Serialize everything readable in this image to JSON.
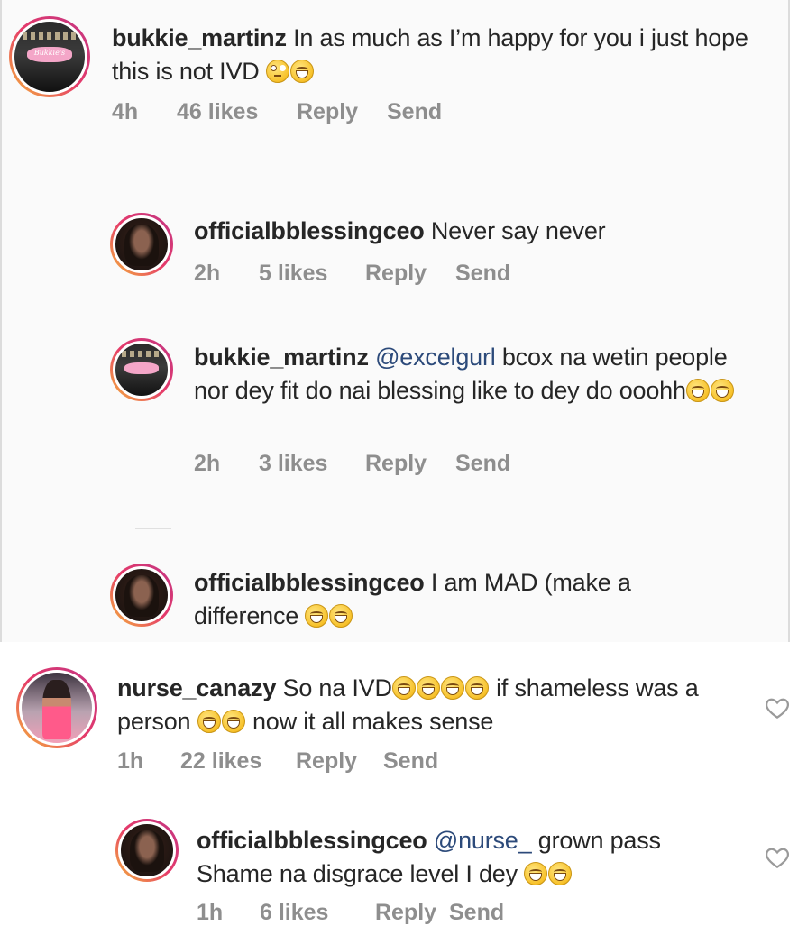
{
  "comments": [
    {
      "username": "bukkie_martinz",
      "avatar": "bukkie-avatar",
      "text_before": " In as much as I’m happy for you i just hope this is not IVD ",
      "emojis": [
        "eye-roll-emoji",
        "laughing-emoji"
      ],
      "time": "4h",
      "likes": "46 likes",
      "reply": "Reply",
      "send": "Send"
    },
    {
      "username": "officialbblessingceo",
      "avatar": "blessing-avatar",
      "text_before": " Never say never",
      "time": "2h",
      "likes": "5 likes",
      "reply": "Reply",
      "send": "Send"
    },
    {
      "username": "bukkie_martinz",
      "avatar": "bukkie-avatar",
      "mention": "@excelgurl",
      "text_before": " bcox na wetin people nor dey fit do nai blessing like to dey do ooohh",
      "emojis": [
        "laughing-emoji",
        "laughing-emoji"
      ],
      "time": "2h",
      "likes": "3 likes",
      "reply": "Reply",
      "send": "Send"
    },
    {
      "username": "officialbblessingceo",
      "avatar": "blessing-avatar",
      "text_before": " I am MAD (make a difference ",
      "emojis": [
        "laughing-emoji",
        "laughing-emoji"
      ]
    },
    {
      "username": "nurse_canazy",
      "avatar": "nurse-avatar",
      "text_before": " So na IVD",
      "text_middle": " if shameless was a person ",
      "text_after": " now it all makes sense",
      "time": "1h",
      "likes": "22 likes",
      "reply": "Reply",
      "send": "Send"
    },
    {
      "username": "officialbblessingceo",
      "avatar": "blessing-avatar",
      "mention": "@nurse_",
      "text_before": " grown pass Shame na disgrace level I dey ",
      "time": "1h",
      "likes": "6 likes",
      "reply": "Reply",
      "send": "Send"
    }
  ],
  "avatar_text": "Bukkie's",
  "colors": {
    "ring_start": "#f5b63a",
    "ring_end": "#c13584",
    "meta": "#8e8e8e",
    "mention": "#2c4a7a"
  }
}
